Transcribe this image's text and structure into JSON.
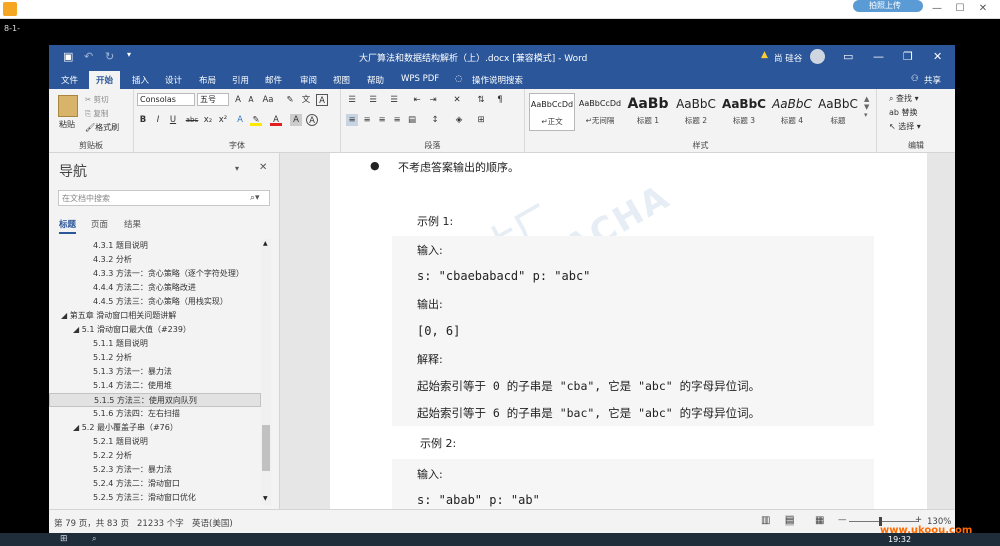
{
  "player": {
    "label": "8-1-",
    "cloud_label": "拍照上传"
  },
  "word": {
    "title": "大厂算法和数据结构解析（上）.docx [兼容模式] - Word",
    "user": "尚 硅谷",
    "share": "共享",
    "tabs": [
      "文件",
      "开始",
      "插入",
      "设计",
      "布局",
      "引用",
      "邮件",
      "审阅",
      "视图",
      "帮助",
      "WPS PDF"
    ],
    "tell_me": "操作说明搜索"
  },
  "ribbon": {
    "clipboard": {
      "paste": "粘贴",
      "cut": "剪切",
      "copy": "复制",
      "format_painter": "格式刷",
      "label": "剪贴板"
    },
    "font": {
      "family": "Consolas",
      "size": "五号",
      "label": "字体"
    },
    "paragraph": {
      "label": "段落"
    },
    "styles": {
      "label": "样式",
      "items": [
        {
          "preview": "AaBbCcDd",
          "name": "↵正文"
        },
        {
          "preview": "AaBbCcDd",
          "name": "↵无间隔"
        },
        {
          "preview": "AaBb",
          "name": "标题 1"
        },
        {
          "preview": "AaBbC",
          "name": "标题 2"
        },
        {
          "preview": "AaBbC",
          "name": "标题 3"
        },
        {
          "preview": "AaBbC",
          "name": "标题 4"
        },
        {
          "preview": "AaBbC",
          "name": "标题"
        }
      ]
    },
    "editing": {
      "find": "查找",
      "replace": "替换",
      "select": "选择",
      "label": "编辑"
    }
  },
  "nav": {
    "title": "导航",
    "search_placeholder": "在文档中搜索",
    "tabs": [
      "标题",
      "页面",
      "结果"
    ],
    "tree": [
      {
        "text": "4.3.1 题目说明",
        "level": 3
      },
      {
        "text": "4.3.2 分析",
        "level": 3
      },
      {
        "text": "4.3.3 方法一：贪心策略（逐个字符处理）",
        "level": 3
      },
      {
        "text": "4.4.4 方法二：贪心策略改进",
        "level": 3
      },
      {
        "text": "4.4.5 方法三：贪心策略（用栈实现）",
        "level": 3
      },
      {
        "text": "◢ 第五章 滑动窗口相关问题讲解",
        "level": 1
      },
      {
        "text": "◢ 5.1 滑动窗口最大值（#239）",
        "level": 2
      },
      {
        "text": "5.1.1 题目说明",
        "level": 3
      },
      {
        "text": "5.1.2 分析",
        "level": 3
      },
      {
        "text": "5.1.3 方法一：暴力法",
        "level": 3
      },
      {
        "text": "5.1.4 方法二：使用堆",
        "level": 3
      },
      {
        "text": "5.1.5 方法三：使用双向队列",
        "level": 3,
        "selected": true
      },
      {
        "text": "5.1.6 方法四：左右扫描",
        "level": 3
      },
      {
        "text": "◢ 5.2 最小覆盖子串（#76）",
        "level": 2
      },
      {
        "text": "5.2.1 题目说明",
        "level": 3
      },
      {
        "text": "5.2.2 分析",
        "level": 3
      },
      {
        "text": "5.2.3 方法一：暴力法",
        "level": 3
      },
      {
        "text": "5.2.4 方法二：滑动窗口",
        "level": 3
      },
      {
        "text": "5.2.5 方法三：滑动窗口优化",
        "level": 3
      }
    ]
  },
  "document": {
    "bullet": "不考虑答案输出的顺序。",
    "example1": "示例 1:",
    "input_label": "输入:",
    "input1": "s: \"cbaebabacd\" p: \"abc\"",
    "output_label": "输出:",
    "output1": "[0, 6]",
    "explain_label": "解释:",
    "explain1": "起始索引等于 0 的子串是 \"cba\", 它是 \"abc\" 的字母异位词。",
    "explain2": "起始索引等于 6 的子串是 \"bac\", 它是 \"abc\" 的字母异位词。",
    "example2": "示例 2:",
    "input_label2": "输入:",
    "input2": "s: \"abab\" p: \"ab\""
  },
  "status": {
    "page": "第 79 页，共 83 页",
    "words": "21233 个字",
    "lang": "英语(美国)",
    "zoom": "130%"
  },
  "overlay": {
    "site": "www.ukoou.com",
    "time": "19:32"
  }
}
